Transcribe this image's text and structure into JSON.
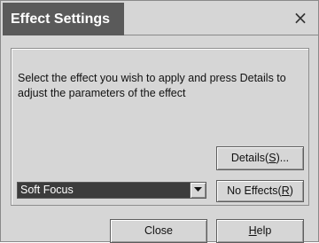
{
  "window": {
    "title": "Effect Settings",
    "close_glyph": "×"
  },
  "body": {
    "instruction": "Select the effect you wish to apply and press Details to adjust the parameters of the effect"
  },
  "effect_select": {
    "selected": "Soft Focus",
    "icon": "chevron-down-icon"
  },
  "buttons": {
    "details": {
      "text": "Details(",
      "mnemonic": "S",
      "suffix": ")..."
    },
    "no_effects": {
      "text": "No Effects(",
      "mnemonic": "R",
      "suffix": ")"
    },
    "close": {
      "label": "Close"
    },
    "help": {
      "mnemonic": "H",
      "rest": "elp"
    }
  },
  "colors": {
    "title_background": "#5a5a5a",
    "dialog_background": "#d6d6d6",
    "selected_background": "#3c3c3c"
  }
}
